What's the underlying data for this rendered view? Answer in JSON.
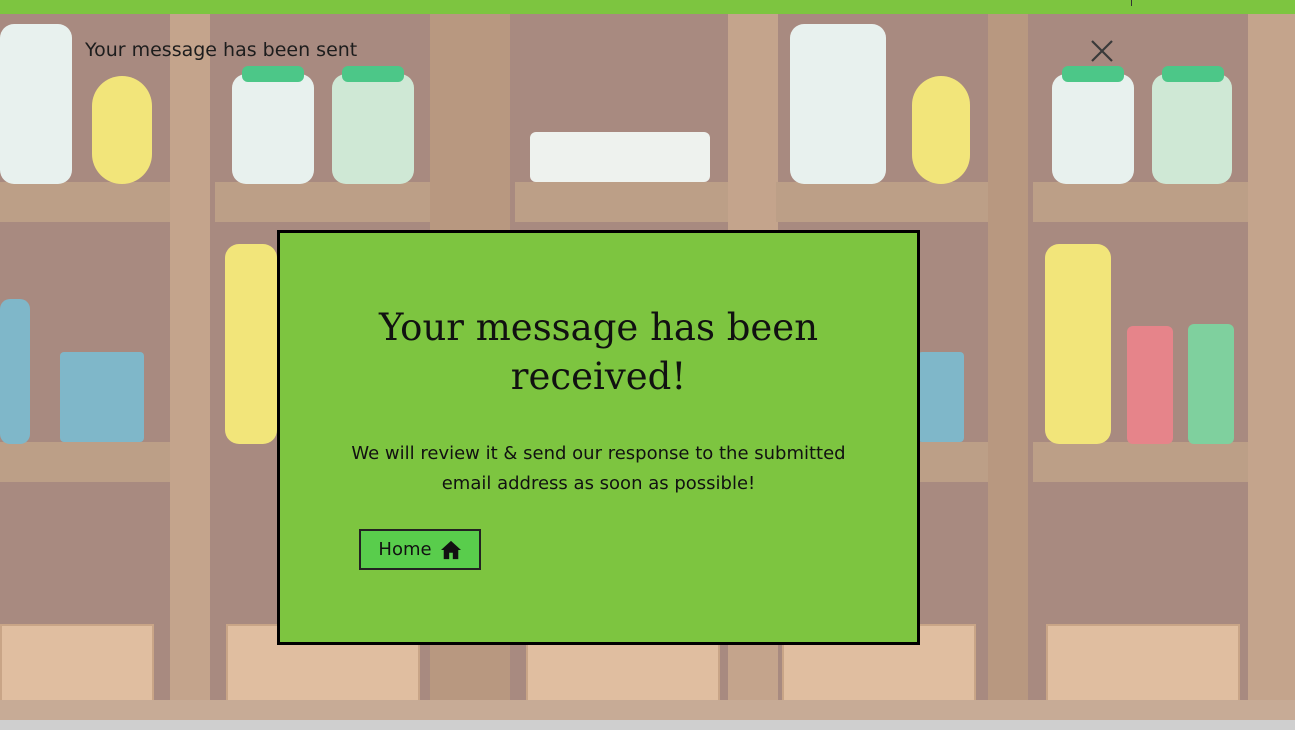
{
  "toast": {
    "message": "Your message has been sent",
    "close_icon": "close-icon"
  },
  "modal": {
    "title": "Your message has been received!",
    "body": "We will review it & send our response to the submitted email address as soon as possible!",
    "home_button_label": "Home",
    "home_icon": "home-icon",
    "background_color": "#7dc540",
    "button_color": "#59cd4c"
  },
  "theme": {
    "topbar_color": "#7dc540"
  }
}
